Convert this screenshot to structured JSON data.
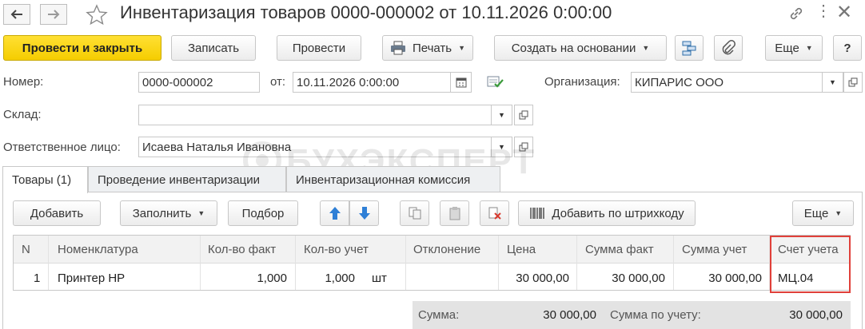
{
  "window": {
    "title": "Инвентаризация товаров 0000-000002 от 10.11.2026 0:00:00"
  },
  "toolbar": {
    "post_close": "Провести и закрыть",
    "save": "Записать",
    "post": "Провести",
    "print": "Печать",
    "create_based": "Создать на основании",
    "more": "Еще",
    "help": "?"
  },
  "form": {
    "number_label": "Номер:",
    "number_value": "0000-000002",
    "date_label": "от:",
    "date_value": "10.11.2026  0:00:00",
    "org_label": "Организация:",
    "org_value": "КИПАРИС ООО",
    "warehouse_label": "Склад:",
    "warehouse_value": "",
    "responsible_label": "Ответственное лицо:",
    "responsible_value": "Исаева Наталья Ивановна"
  },
  "watermark": "БУХЭКСПЕРТ",
  "tabs": [
    {
      "label": "Товары (1)",
      "active": true
    },
    {
      "label": "Проведение инвентаризации",
      "active": false
    },
    {
      "label": "Инвентаризационная комиссия",
      "active": false
    }
  ],
  "table_toolbar": {
    "add": "Добавить",
    "fill": "Заполнить",
    "select": "Подбор",
    "add_barcode": "Добавить по штрихкоду",
    "more": "Еще"
  },
  "table": {
    "columns": [
      "N",
      "Номенклатура",
      "Кол-во факт",
      "Кол-во учет",
      "Отклонение",
      "Цена",
      "Сумма факт",
      "Сумма учет",
      "Счет учета"
    ],
    "rows": [
      {
        "n": "1",
        "item": "Принтер HP",
        "qty_fact": "1,000",
        "qty_acc": "1,000",
        "unit": "шт",
        "deviation": "",
        "price": "30 000,00",
        "sum_fact": "30 000,00",
        "sum_acc": "30 000,00",
        "account": "МЦ.04"
      }
    ]
  },
  "totals": {
    "sum_label": "Сумма:",
    "sum_value": "30 000,00",
    "sum_acc_label": "Сумма по учету:",
    "sum_acc_value": "30 000,00"
  },
  "colors": {
    "primary_button": "#f5cd00",
    "highlight_border": "#e0403a",
    "arrow_blue": "#2e7fd6",
    "totals_bg": "#e3e3e3"
  }
}
